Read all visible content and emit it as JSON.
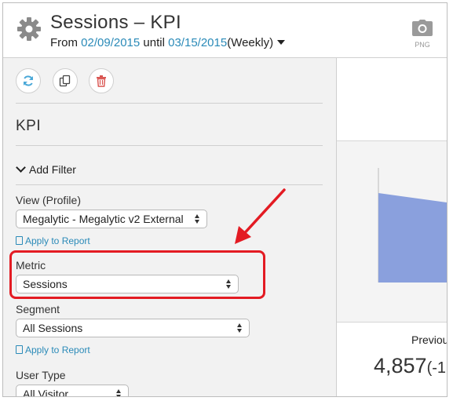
{
  "header": {
    "title": "Sessions – KPI",
    "from_label": "From",
    "start_date": "02/09/2015",
    "until_label": "until",
    "end_date": "03/15/2015",
    "interval": "(Weekly)",
    "export_label": "PNG"
  },
  "toolbar": {
    "icons": [
      "refresh-icon",
      "copy-icon",
      "trash-icon"
    ]
  },
  "widget": {
    "name": "KPI",
    "add_filter_label": "Add Filter"
  },
  "fields": {
    "view_profile": {
      "label": "View (Profile)",
      "value": "Megalytic - Megalytic v2 External",
      "apply_link": "Apply to Report"
    },
    "metric": {
      "label": "Metric",
      "value": "Sessions"
    },
    "segment": {
      "label": "Segment",
      "value": "All Sessions",
      "apply_link": "Apply to Report"
    },
    "user_type": {
      "label": "User Type",
      "value": "All Visitor"
    }
  },
  "preview": {
    "previous_label": "Previou",
    "previous_value": "4,857",
    "previous_change": "(-1"
  },
  "colors": {
    "accent_link": "#2a8ab8",
    "highlight": "#e31b23",
    "chart_fill": "#8aa0dd",
    "delete_icon": "#d9534f",
    "refresh_icon": "#4aa8d8"
  }
}
